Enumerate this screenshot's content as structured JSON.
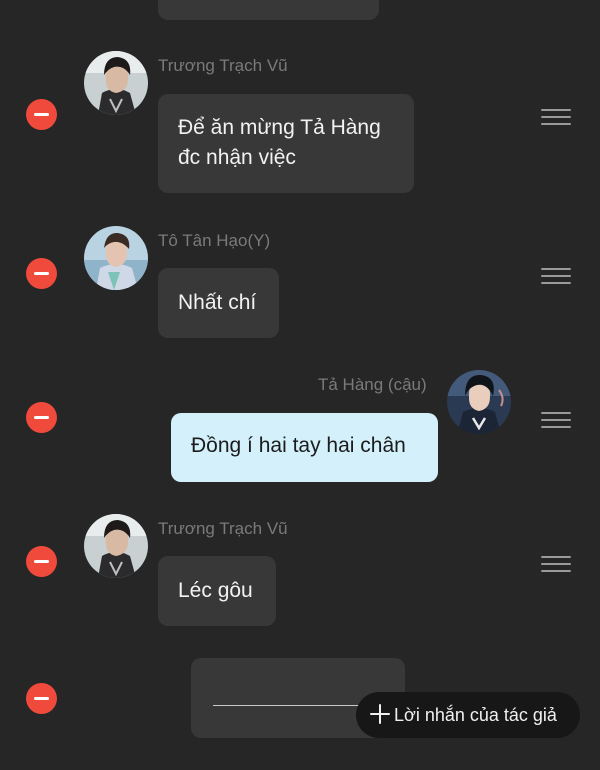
{
  "messages": [
    {
      "id": "msg-1",
      "speaker": "Trương Trạch Vũ",
      "side": "left",
      "text_lines": [
        "Để ăn mừng Tả Hàng",
        "đc nhận việc"
      ]
    },
    {
      "id": "msg-2",
      "speaker": "Tô Tân Hạo(Y)",
      "side": "left",
      "text_lines": [
        "Nhất chí"
      ]
    },
    {
      "id": "msg-3",
      "speaker": "Tả Hàng (cậu)",
      "side": "right",
      "text_lines": [
        "Đồng í hai tay hai chân"
      ]
    },
    {
      "id": "msg-4",
      "speaker": "Trương Trạch Vũ",
      "side": "left",
      "text_lines": [
        "Léc gôu"
      ]
    }
  ],
  "author_note_button": {
    "label": "Lời nhắn của tác giả",
    "icon": "plus-icon"
  },
  "colors": {
    "background": "#262626",
    "bubble": "#383838",
    "bubble_self": "#d3f0fb",
    "remove_button": "#f04a3c",
    "speaker_name": "#7a7a7a"
  }
}
